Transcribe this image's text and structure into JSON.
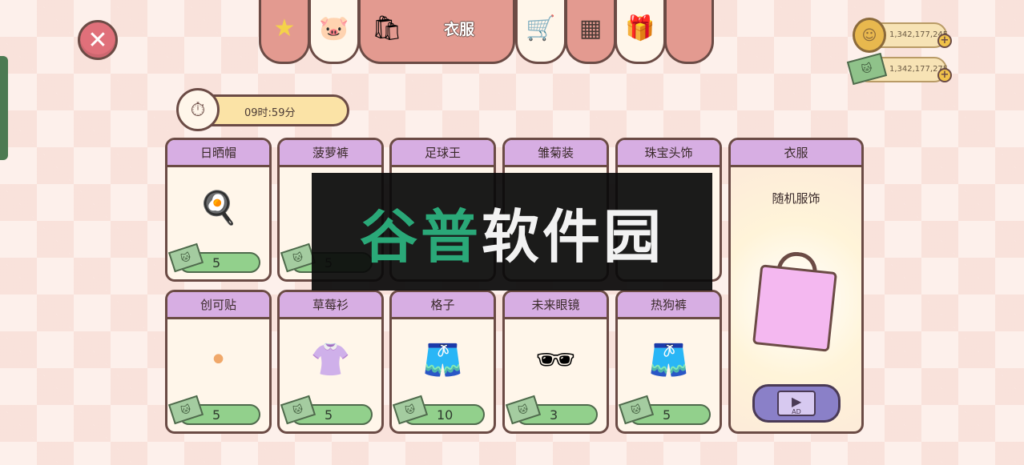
{
  "top_tabs": [
    {
      "icon": "★",
      "icon_name": "star-icon",
      "active": false
    },
    {
      "icon": "🐷",
      "icon_name": "piggy-bank-icon",
      "active": false
    },
    {
      "icon": "🛍",
      "icon_name": "shopping-bag-icon",
      "label": "衣服",
      "active": true
    },
    {
      "icon": "🛒",
      "icon_name": "shopping-cart-icon",
      "active": false
    },
    {
      "icon": "▦",
      "icon_name": "floor-tiles-icon",
      "active": false
    },
    {
      "icon": "🎁",
      "icon_name": "gift-box-icon",
      "active": false
    },
    {
      "icon": "",
      "icon_name": "",
      "active": false
    }
  ],
  "currency": {
    "coins": "1,342,177,245",
    "cash": "1,342,177,275"
  },
  "timer": {
    "text": "09时:59分"
  },
  "items": [
    {
      "name": "日晒帽",
      "icon": "🍳",
      "price": "5"
    },
    {
      "name": "菠萝裤",
      "icon": "",
      "price": "5"
    },
    {
      "name": "足球王",
      "icon": "",
      "price": ""
    },
    {
      "name": "雏菊装",
      "icon": "",
      "price": ""
    },
    {
      "name": "珠宝头饰",
      "icon": "",
      "price": ""
    },
    {
      "name": "创可贴",
      "icon": "•",
      "price": "5"
    },
    {
      "name": "草莓衫",
      "icon": "👚",
      "price": "5"
    },
    {
      "name": "格子",
      "icon": "🩳",
      "price": "10"
    },
    {
      "name": "未来眼镜",
      "icon": "🕶",
      "price": "3"
    },
    {
      "name": "热狗裤",
      "icon": "🩳",
      "price": "5"
    }
  ],
  "random_card": {
    "title": "衣服",
    "subtitle": "随机服饰",
    "ad_label": "AD"
  },
  "watermark": {
    "part1": "谷普",
    "part2": "软件园"
  },
  "colors": {
    "accent_pink": "#e39a90",
    "header_purple": "#d7aee3",
    "price_green": "#92d08c"
  }
}
